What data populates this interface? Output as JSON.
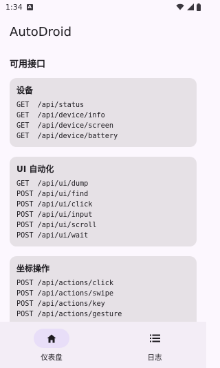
{
  "status_bar": {
    "time": "1:34",
    "notif_glyph": "A"
  },
  "app": {
    "title": "AutoDroid"
  },
  "section": {
    "title": "可用接口"
  },
  "cards": [
    {
      "title": "设备",
      "endpoints": [
        "GET  /api/status",
        "GET  /api/device/info",
        "GET  /api/device/screen",
        "GET  /api/device/battery"
      ]
    },
    {
      "title": "UI 自动化",
      "endpoints": [
        "GET  /api/ui/dump",
        "POST /api/ui/find",
        "POST /api/ui/click",
        "POST /api/ui/input",
        "POST /api/ui/scroll",
        "POST /api/ui/wait"
      ]
    },
    {
      "title": "坐标操作",
      "endpoints": [
        "POST /api/actions/click",
        "POST /api/actions/swipe",
        "POST /api/actions/key",
        "POST /api/actions/gesture"
      ]
    }
  ],
  "bottom_nav": {
    "items": [
      {
        "label": "仪表盘",
        "icon": "home-icon",
        "active": true
      },
      {
        "label": "日志",
        "icon": "list-icon",
        "active": false
      }
    ]
  }
}
